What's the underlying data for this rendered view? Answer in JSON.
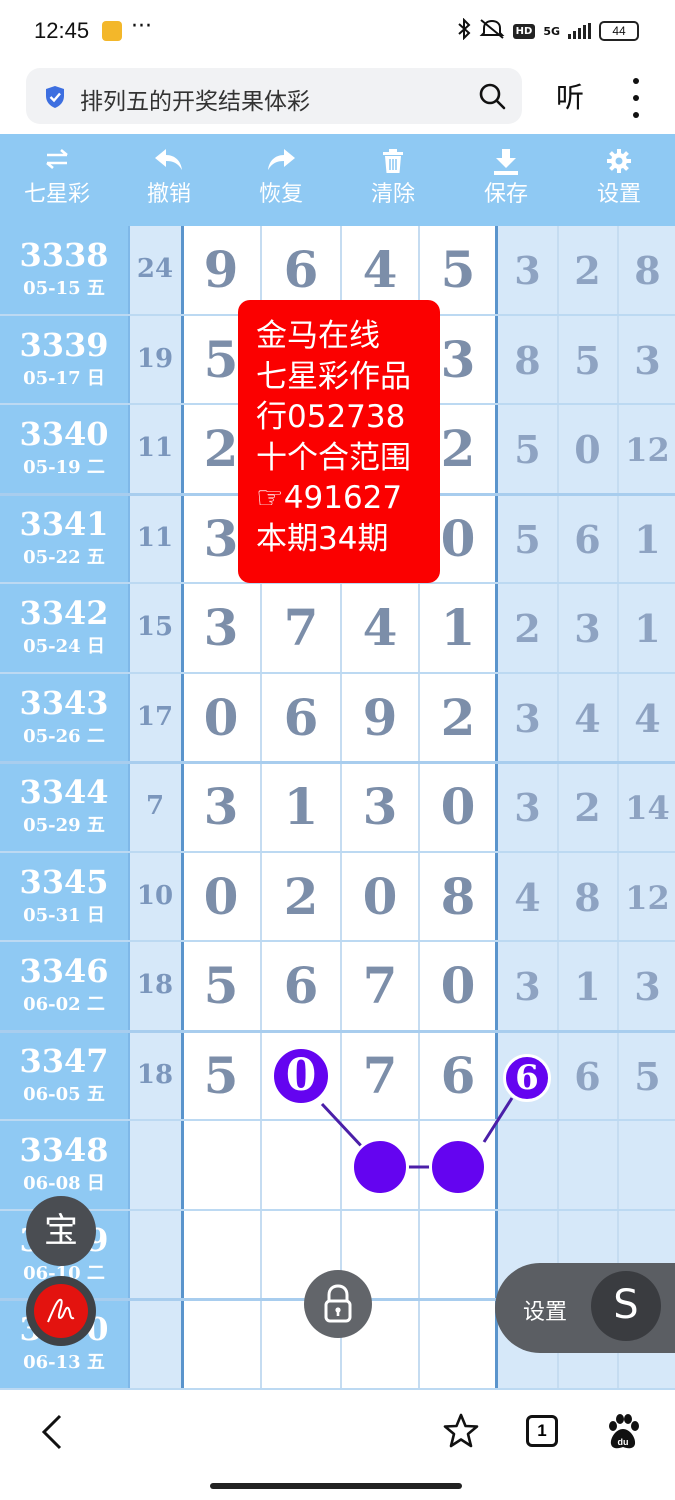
{
  "status_bar": {
    "time": "12:45",
    "more": "···",
    "network": "5G",
    "hd": "HD",
    "battery": "44"
  },
  "search": {
    "query": "排列五的开奖结果体彩",
    "listen_label": "听"
  },
  "toolbar": {
    "items": [
      {
        "label": "七星彩",
        "icon": "swap-arrows-icon"
      },
      {
        "label": "撤销",
        "icon": "undo-icon"
      },
      {
        "label": "恢复",
        "icon": "redo-icon"
      },
      {
        "label": "清除",
        "icon": "trash-icon"
      },
      {
        "label": "保存",
        "icon": "download-icon"
      },
      {
        "label": "设置",
        "icon": "gear-icon"
      }
    ]
  },
  "rows": [
    {
      "period": "3338",
      "date": "05-15 五",
      "sum": "24",
      "main": [
        "9",
        "6",
        "4",
        "5"
      ],
      "extra": [
        "3",
        "2",
        "8"
      ]
    },
    {
      "period": "3339",
      "date": "05-17 日",
      "sum": "19",
      "main": [
        "5",
        "",
        "",
        "3"
      ],
      "extra": [
        "8",
        "5",
        "3"
      ]
    },
    {
      "period": "3340",
      "date": "05-19 二",
      "sum": "11",
      "main": [
        "2",
        "",
        "",
        "2"
      ],
      "extra": [
        "5",
        "0",
        "12"
      ]
    },
    {
      "period": "3341",
      "date": "05-22 五",
      "sum": "11",
      "main": [
        "3",
        "",
        "",
        "0"
      ],
      "extra": [
        "5",
        "6",
        "1"
      ]
    },
    {
      "period": "3342",
      "date": "05-24 日",
      "sum": "15",
      "main": [
        "3",
        "7",
        "4",
        "1"
      ],
      "extra": [
        "2",
        "3",
        "1"
      ]
    },
    {
      "period": "3343",
      "date": "05-26 二",
      "sum": "17",
      "main": [
        "0",
        "6",
        "9",
        "2"
      ],
      "extra": [
        "3",
        "4",
        "4"
      ]
    },
    {
      "period": "3344",
      "date": "05-29 五",
      "sum": "7",
      "main": [
        "3",
        "1",
        "3",
        "0"
      ],
      "extra": [
        "3",
        "2",
        "14"
      ]
    },
    {
      "period": "3345",
      "date": "05-31 日",
      "sum": "10",
      "main": [
        "0",
        "2",
        "0",
        "8"
      ],
      "extra": [
        "4",
        "8",
        "12"
      ]
    },
    {
      "period": "3346",
      "date": "06-02 二",
      "sum": "18",
      "main": [
        "5",
        "6",
        "7",
        "0"
      ],
      "extra": [
        "3",
        "1",
        "3"
      ]
    },
    {
      "period": "3347",
      "date": "06-05 五",
      "sum": "18",
      "main": [
        "5",
        "",
        "7",
        "6"
      ],
      "extra": [
        "",
        "6",
        "5"
      ]
    },
    {
      "period": "3348",
      "date": "06-08 日",
      "sum": "",
      "main": [
        "",
        "",
        "",
        ""
      ],
      "extra": [
        "",
        "",
        ""
      ]
    },
    {
      "period": "3349",
      "date": "06-10 二",
      "sum": "",
      "main": [
        "",
        "",
        "",
        ""
      ],
      "extra": [
        "",
        "",
        ""
      ]
    },
    {
      "period": "3350",
      "date": "06-13 五",
      "sum": "",
      "main": [
        "",
        "",
        "",
        ""
      ],
      "extra": [
        "",
        "",
        ""
      ]
    }
  ],
  "promo": {
    "lines": [
      "金马在线",
      "七星彩作品",
      "行052738",
      "十个合范围",
      "☞491627",
      "本期34期"
    ],
    "color": "#fb0000"
  },
  "markers": {
    "ball_a": "0",
    "ball_b": "6",
    "color": "#6404f0"
  },
  "floating": {
    "bao_label": "宝",
    "settings_label": "设置",
    "s_label": "S"
  },
  "bottom_nav": {
    "tab_count": "1"
  }
}
